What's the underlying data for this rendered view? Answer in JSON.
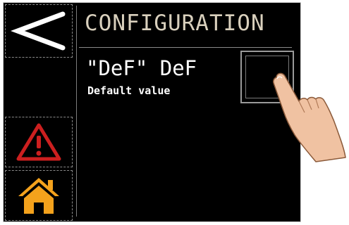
{
  "screen": {
    "title": "CONFIGURATION",
    "parameter": "\"DeF\" DeF",
    "description": "Default value"
  },
  "sidebar": {
    "back_icon": "back-arrow-icon",
    "alarm_icon": "warning-icon",
    "home_icon": "home-icon"
  },
  "colors": {
    "background": "#000000",
    "title": "#d9d0bd",
    "text": "#ffffff",
    "alarm": "#cc1f1f",
    "home": "#f4a21c"
  }
}
